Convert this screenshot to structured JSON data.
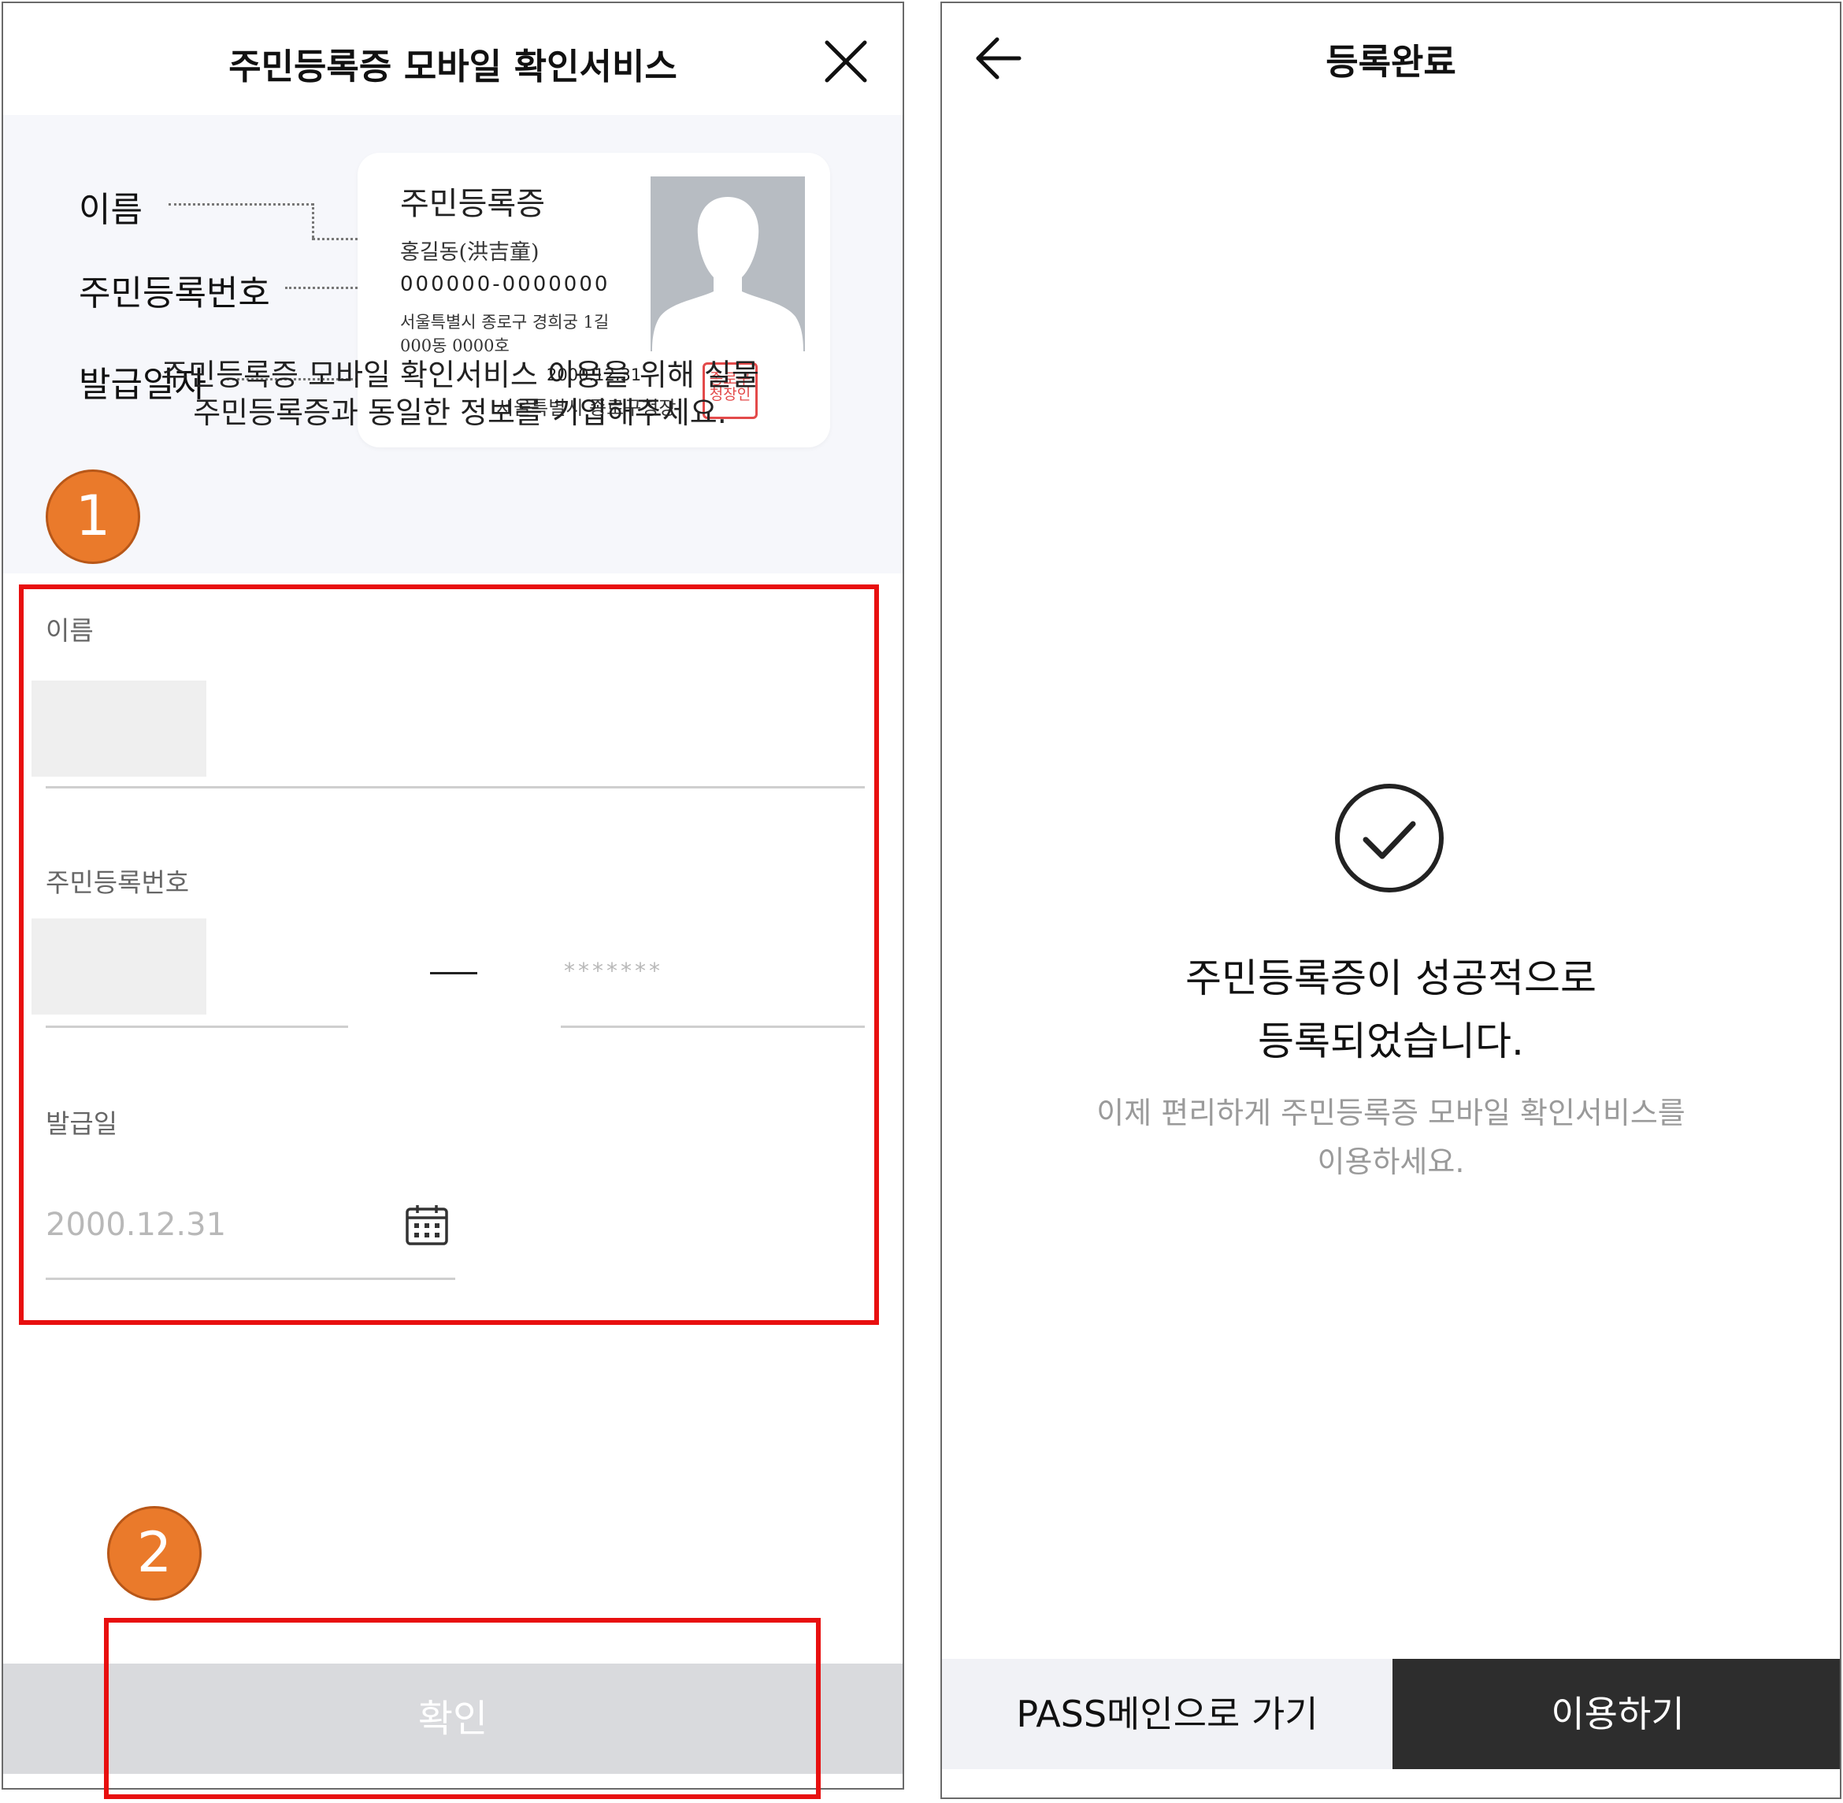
{
  "left_screen": {
    "title": "주민등록증 모바일 확인서비스",
    "annotations": {
      "name": "이름",
      "id_number": "주민등록번호",
      "issue_date": "발급일자"
    },
    "card": {
      "title": "주민등록증",
      "name": "홍길동(洪吉童)",
      "number": "000000-0000000",
      "address_line1": "서울특별시 종로구 경희궁 1길",
      "address_line2": "000동 0000호",
      "date": "2000.12.31",
      "issuer": "서울특별시 종로구청장",
      "seal_line1": "종로구",
      "seal_line2": "청장인"
    },
    "step1": "1",
    "notice_line1": "주민등록증 모바일 확인서비스 이용을 위해 실물",
    "notice_line2": "주민등록증과 동일한 정보를 기입해주세요.",
    "form": {
      "name_label": "이름",
      "id_label": "주민등록번호",
      "id_back_placeholder": "*******",
      "date_label": "발급일",
      "date_placeholder": "2000.12.31"
    },
    "step2": "2",
    "confirm_label": "확인"
  },
  "right_screen": {
    "title": "등록완료",
    "success_line1": "주민등록증이 성공적으로",
    "success_line2": "등록되었습니다.",
    "sub_line1": "이제 편리하게 주민등록증 모바일 확인서비스를",
    "sub_line2": "이용하세요.",
    "pass_button": "PASS메인으로 가기",
    "use_button": "이용하기"
  },
  "colors": {
    "highlight_red": "#e80f0f",
    "badge_orange": "#ea7a2b",
    "dark_button": "#2d2d2d",
    "disabled_button": "#d9dadd",
    "seal_red": "#e34a4a"
  },
  "icons": {
    "close": "close-icon",
    "back": "arrow-left-icon",
    "calendar": "calendar-icon",
    "check": "check-circle-icon",
    "person": "person-silhouette-icon"
  }
}
